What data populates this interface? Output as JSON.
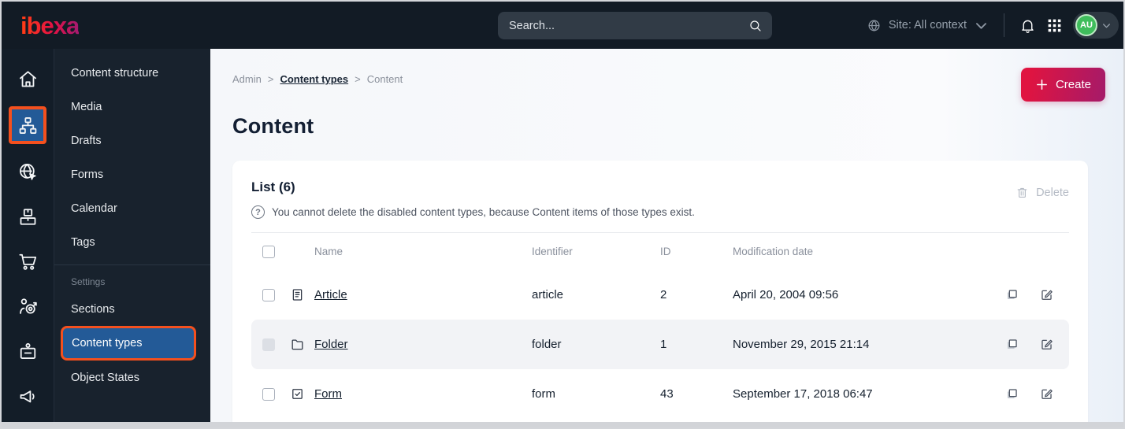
{
  "topbar": {
    "logo": "ibexa",
    "search_placeholder": "Search...",
    "site_context": "Site: All context",
    "avatar_initials": "AU"
  },
  "icon_rail": {
    "items": [
      {
        "name": "home"
      },
      {
        "name": "content-structure",
        "active": true
      },
      {
        "name": "site-globe"
      },
      {
        "name": "product-catalog"
      },
      {
        "name": "commerce-cart"
      },
      {
        "name": "personalization-target"
      },
      {
        "name": "admin-badge"
      },
      {
        "name": "marketing-megaphone"
      }
    ]
  },
  "sidebar": {
    "items": [
      {
        "label": "Content structure"
      },
      {
        "label": "Media"
      },
      {
        "label": "Drafts"
      },
      {
        "label": "Forms"
      },
      {
        "label": "Calendar"
      },
      {
        "label": "Tags"
      }
    ],
    "settings_label": "Settings",
    "settings_items": [
      {
        "label": "Sections"
      },
      {
        "label": "Content types",
        "active": true
      },
      {
        "label": "Object States"
      }
    ]
  },
  "breadcrumb": {
    "separator": ">",
    "items": [
      "Admin",
      "Content types",
      "Content"
    ]
  },
  "page": {
    "title": "Content",
    "create_label": "Create"
  },
  "list": {
    "title": "List (6)",
    "info": "You cannot delete the disabled content types, because Content items of those types exist.",
    "delete_label": "Delete",
    "question_glyph": "?",
    "columns": {
      "name": "Name",
      "identifier": "Identifier",
      "id": "ID",
      "modified": "Modification date"
    },
    "rows": [
      {
        "name": "Article",
        "identifier": "article",
        "id": "2",
        "modified": "April 20, 2004 09:56",
        "icon": "article-document-icon",
        "checkbox_disabled": false
      },
      {
        "name": "Folder",
        "identifier": "folder",
        "id": "1",
        "modified": "November 29, 2015 21:14",
        "icon": "folder-icon",
        "checkbox_disabled": true
      },
      {
        "name": "Form",
        "identifier": "form",
        "id": "43",
        "modified": "September 17, 2018 06:47",
        "icon": "form-checkbox-icon",
        "checkbox_disabled": false
      }
    ]
  },
  "colors": {
    "topbar_bg": "#121b25",
    "sidebar_bg": "#18222d",
    "active_blue": "#235a97",
    "annotation_orange": "#f4501e",
    "brand_gradient_start": "#e01440",
    "brand_gradient_end": "#a81a67",
    "avatar_green": "#3fbd5c",
    "row_stripe": "#f2f3f6",
    "text_dark": "#131f33",
    "text_muted": "#8a909c"
  }
}
